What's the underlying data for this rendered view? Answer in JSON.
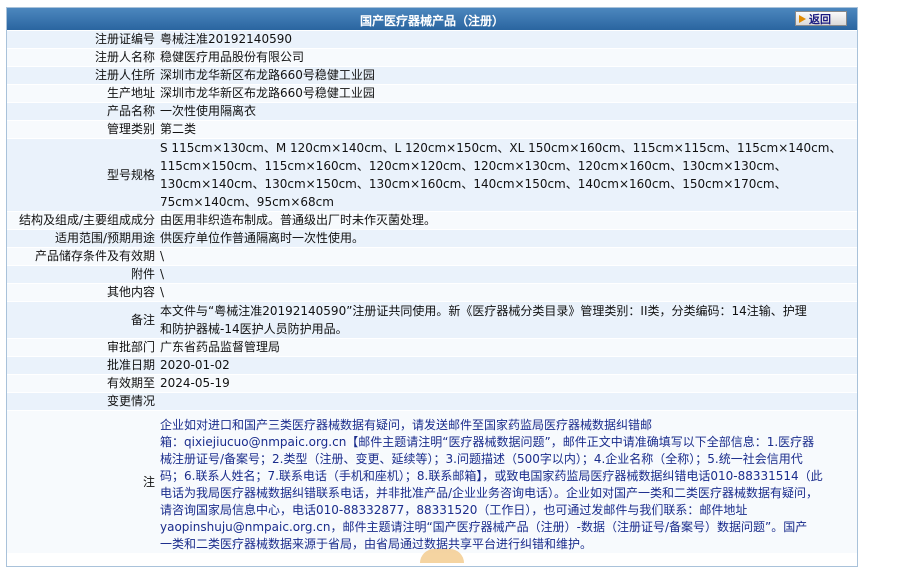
{
  "header": {
    "title": "国产医疗器械产品（注册）",
    "back_label": "返回"
  },
  "rows": [
    {
      "label": "注册证编号",
      "value": "粤械注准20192140590"
    },
    {
      "label": "注册人名称",
      "value": "稳健医疗用品股份有限公司"
    },
    {
      "label": "注册人住所",
      "value": "深圳市龙华新区布龙路660号稳健工业园"
    },
    {
      "label": "生产地址",
      "value": "深圳市龙华新区布龙路660号稳健工业园"
    },
    {
      "label": "产品名称",
      "value": "一次性使用隔离衣"
    },
    {
      "label": "管理类别",
      "value": "第二类"
    },
    {
      "label": "型号规格",
      "lines": [
        "S 115cm×130cm、M 120cm×140cm、L 120cm×150cm、XL 150cm×160cm、115cm×115cm、115cm×140cm、",
        "115cm×150cm、115cm×160cm、120cm×120cm、120cm×130cm、120cm×160cm、130cm×130cm、",
        "130cm×140cm、130cm×150cm、130cm×160cm、140cm×150cm、140cm×160cm、150cm×170cm、",
        "75cm×140cm、95cm×68cm"
      ]
    },
    {
      "label": "结构及组成/主要组成成分",
      "value": "由医用非织造布制成。普通级出厂时未作灭菌处理。"
    },
    {
      "label": "适用范围/预期用途",
      "value": "供医疗单位作普通隔离时一次性使用。"
    },
    {
      "label": "产品储存条件及有效期",
      "value": "\\"
    },
    {
      "label": "附件",
      "value": "\\"
    },
    {
      "label": "其他内容",
      "value": "\\"
    },
    {
      "label": "备注",
      "lines": [
        "本文件与“粤械注准20192140590”注册证共同使用。新《医疗器械分类目录》管理类别：II类，分类编码：14注输、护理",
        "和防护器械-14医护人员防护用品。"
      ]
    },
    {
      "label": "审批部门",
      "value": "广东省药品监督管理局"
    },
    {
      "label": "批准日期",
      "value": "2020-01-02"
    },
    {
      "label": "有效期至",
      "value": "2024-05-19"
    },
    {
      "label": "变更情况",
      "value": ""
    }
  ],
  "note": {
    "label": "注",
    "lines": [
      "企业如对进口和国产三类医疗器械数据有疑问，请发送邮件至国家药监局医疗器械数据纠错邮",
      "箱：qixiejiucuo@nmpaic.org.cn【邮件主题请注明“医疗器械数据问题”，邮件正文中请准确填写以下全部信息：1.医疗器",
      "械注册证号/备案号；2.类型（注册、变更、延续等）；3.问题描述（500字以内）；4.企业名称（全称）；5.统一社会信用代",
      "码；6.联系人姓名；7.联系电话（手机和座机）；8.联系邮箱】，或致电国家药监局医疗器械数据纠错电话010-88331514（此",
      "电话为我局医疗器械数据纠错联系电话，并非批准产品/企业业务咨询电话）。企业如对国产一类和二类医疗器械数据有疑问，",
      "请咨询国家局信息中心，电话010-88332877，88331520（工作日），也可通过发邮件与我们联系：邮件地址",
      "yaopinshuju@nmpaic.org.cn，邮件主题请注明“国产医疗器械产品（注册）-数据（注册证号/备案号）数据问题”。国产",
      "一类和二类医疗器械数据来源于省局，由省局通过数据共享平台进行纠错和维护。"
    ]
  },
  "colors": {
    "header_bg": "#2a65a0",
    "row_odd": "#eaf2fb",
    "row_even": "#f7fafd",
    "note_text": "#1a2c8c"
  }
}
